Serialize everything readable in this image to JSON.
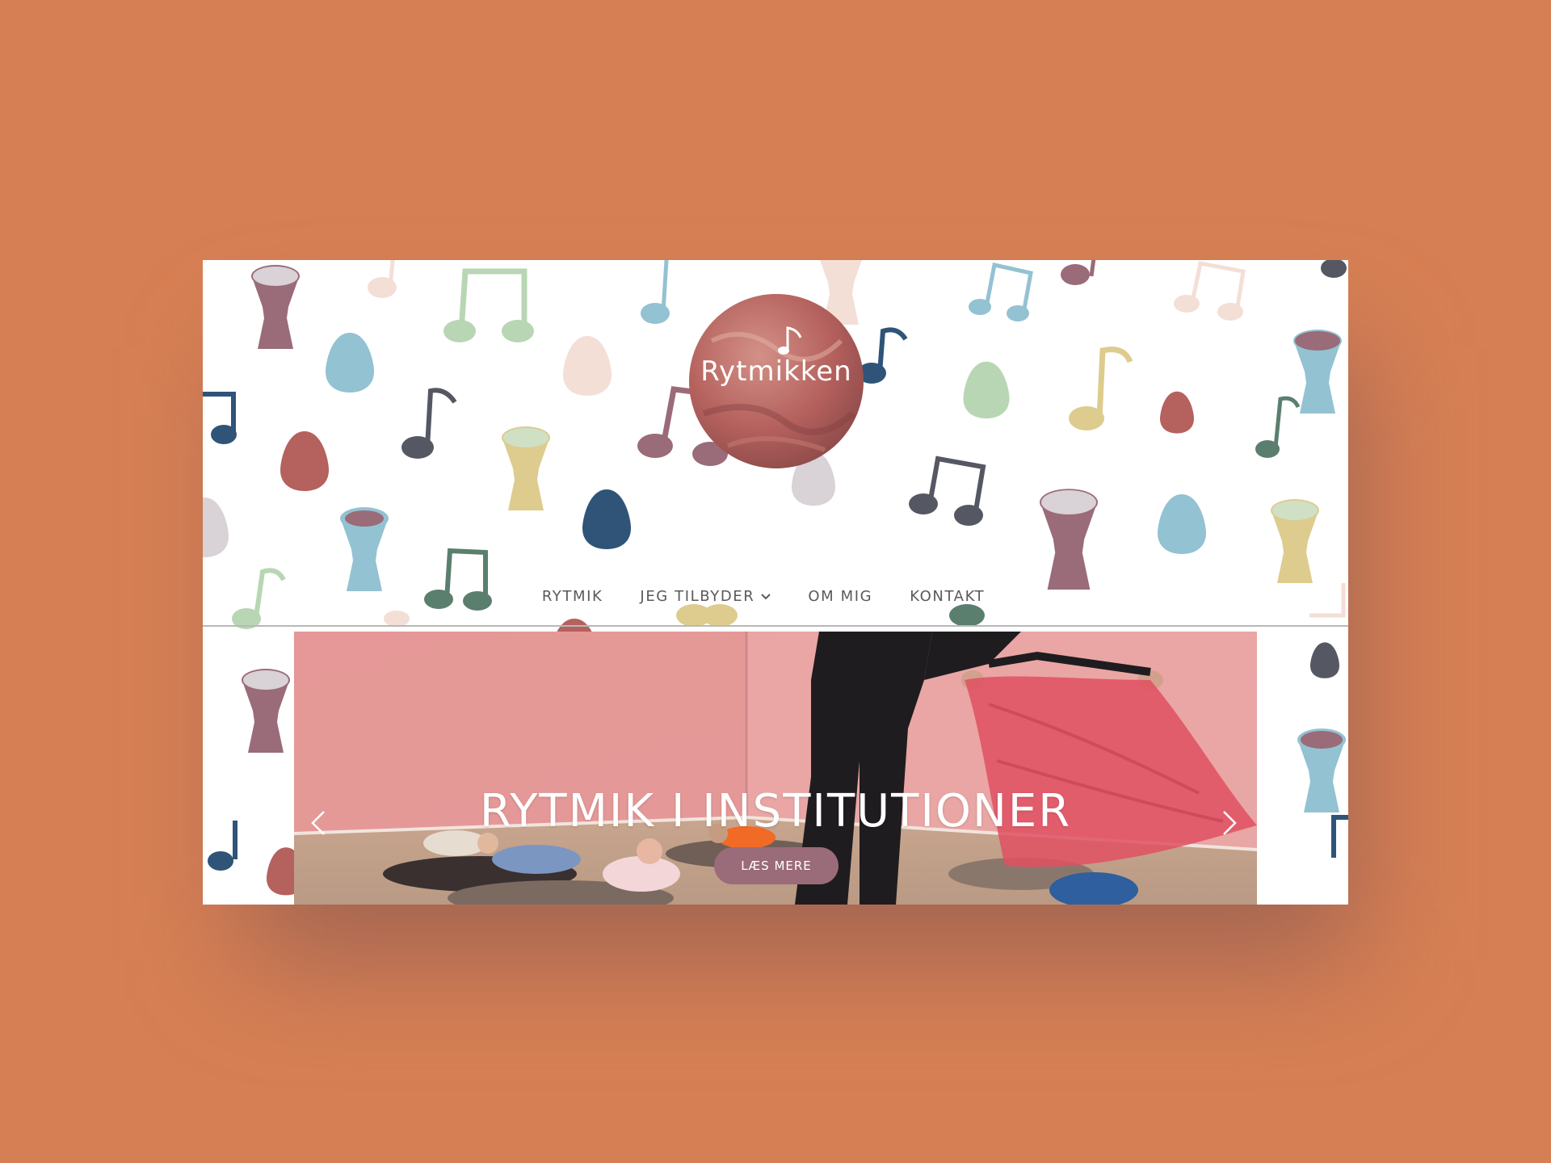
{
  "page": {
    "background_color": "#D77F54"
  },
  "logo": {
    "text": "Rytmikken",
    "color": "#B5615E",
    "icon": "music-note-icon"
  },
  "nav": {
    "items": [
      {
        "label": "RYTMIK",
        "has_dropdown": false
      },
      {
        "label": "JEG TILBYDER",
        "has_dropdown": true
      },
      {
        "label": "OM MIG",
        "has_dropdown": false
      },
      {
        "label": "KONTAKT",
        "has_dropdown": false
      }
    ],
    "dropdown_icon": "chevron-down-icon"
  },
  "slider": {
    "title": "RYTMIK I INSTITUTIONER",
    "button_label": "LÆS MERE",
    "button_color": "#9A6B78",
    "prev_icon": "chevron-left-icon",
    "next_icon": "chevron-right-icon"
  },
  "palette": {
    "mauve": "#9A6B78",
    "teal": "#93C2D2",
    "sage": "#B9D6B4",
    "navy": "#2F5478",
    "brick": "#B5615E",
    "sand": "#DDCC8E",
    "blush": "#F3DFD6",
    "charcoal": "#555862"
  }
}
